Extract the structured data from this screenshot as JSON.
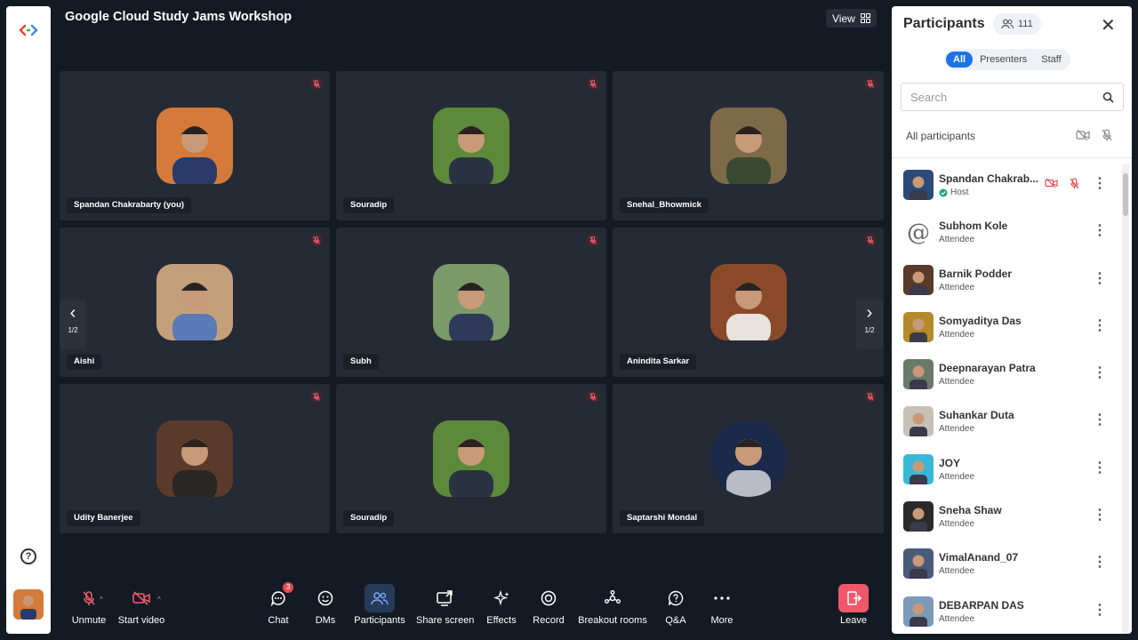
{
  "meeting": {
    "title": "Google Cloud Study Jams Workshop",
    "view_label": "View"
  },
  "tiles": [
    {
      "name": "Spandan Chakrabarty (you)",
      "bg": "#d47a3a",
      "fg": "#2a3a6a",
      "round": false
    },
    {
      "name": "Souradip",
      "bg": "#5c8a3a",
      "fg": "#2b3242",
      "round": false
    },
    {
      "name": "Snehal_Bhowmick",
      "bg": "#7d6a48",
      "fg": "#3a4a30",
      "round": false
    },
    {
      "name": "Aishi",
      "bg": "#c4a07a",
      "fg": "#5a7ab8",
      "round": false
    },
    {
      "name": "Subh",
      "bg": "#7b9a6a",
      "fg": "#2f3a5a",
      "round": false
    },
    {
      "name": "Anindita Sarkar",
      "bg": "#8a4a2a",
      "fg": "#e7e2dc",
      "round": false
    },
    {
      "name": "Udity Banerjee",
      "bg": "#5a3a2a",
      "fg": "#2a2626",
      "round": false
    },
    {
      "name": "Souradip",
      "bg": "#5c8a3a",
      "fg": "#2b3242",
      "round": false
    },
    {
      "name": "Saptarshi Mondal",
      "bg": "#1c2a4a",
      "fg": "#b9bcc6",
      "round": true
    }
  ],
  "pagination": {
    "left": "1/2",
    "right": "1/2"
  },
  "toolbar": {
    "unmute": "Unmute",
    "start_video": "Start video",
    "chat": "Chat",
    "chat_badge": "3",
    "dms": "DMs",
    "participants": "Participants",
    "share_screen": "Share screen",
    "effects": "Effects",
    "record": "Record",
    "breakout_rooms": "Breakout rooms",
    "qa": "Q&A",
    "more": "More",
    "leave": "Leave"
  },
  "panel": {
    "title": "Participants",
    "count": "111",
    "tabs": {
      "all": "All",
      "presenters": "Presenters",
      "staff": "Staff"
    },
    "search_placeholder": "Search",
    "all_participants": "All participants",
    "people": [
      {
        "name": "Spandan Chakrab...",
        "role": "Host",
        "bg": "#2a4a7a"
      },
      {
        "name": "Subhom Kole",
        "role": "Attendee",
        "bg": "#ffffff"
      },
      {
        "name": "Barnik Podder",
        "role": "Attendee",
        "bg": "#5a3a2a"
      },
      {
        "name": "Somyaditya Das",
        "role": "Attendee",
        "bg": "#b58a2a"
      },
      {
        "name": "Deepnarayan Patra",
        "role": "Attendee",
        "bg": "#6a7a6a"
      },
      {
        "name": "Suhankar Duta",
        "role": "Attendee",
        "bg": "#c7c0b6"
      },
      {
        "name": "JOY",
        "role": "Attendee",
        "bg": "#3ab7d8"
      },
      {
        "name": "Sneha Shaw",
        "role": "Attendee",
        "bg": "#2a2a2a"
      },
      {
        "name": "VimalAnand_07",
        "role": "Attendee",
        "bg": "#4a5a7a"
      },
      {
        "name": "DEBARPAN DAS",
        "role": "Attendee",
        "bg": "#7a9ab8"
      }
    ]
  }
}
